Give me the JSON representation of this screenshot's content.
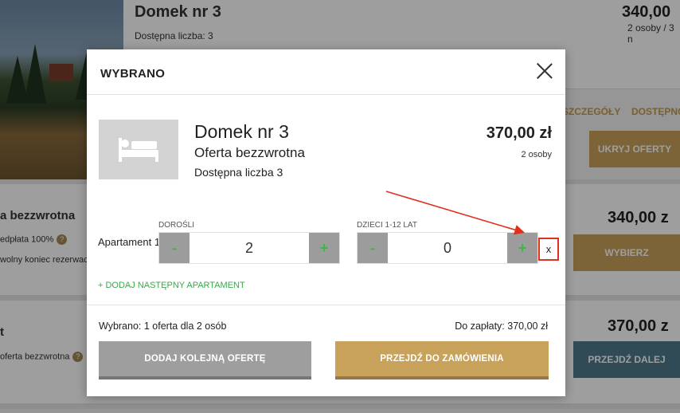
{
  "background": {
    "card1": {
      "title": "Domek nr 3",
      "availability": "Dostępna liczba: 3",
      "price": "340,00",
      "persons": "2 osoby / 3 n"
    },
    "links": {
      "details": "SZCZEGÓŁY",
      "availability": "DOSTĘPNO"
    },
    "hide_offers_button": "UKRYJ OFERTY",
    "card2": {
      "title": "a bezzwrotna",
      "line1": "edpłata 100%",
      "line2": "wolny koniec rezerwac",
      "price": "340,00 z",
      "button": "WYBIERZ"
    },
    "card3": {
      "title": "t",
      "line1": "ofertа bezzwrotna",
      "price": "370,00 z",
      "button": "PRZEJDŹ DALEJ"
    },
    "question_mark": "?"
  },
  "modal": {
    "title": "WYBRANO",
    "room": {
      "name": "Domek nr 3",
      "offer": "Oferta bezzwrotna",
      "availability": "Dostępna liczba 3",
      "price": "370,00 zł",
      "persons": "2 osoby"
    },
    "apartment_label": "Apartament 1",
    "adults": {
      "label": "DOROŚLI",
      "value": "2",
      "minus": "-",
      "plus": "+"
    },
    "children": {
      "label": "DZIECI 1-12 LAT",
      "value": "0",
      "minus": "-",
      "plus": "+"
    },
    "remove_label": "x",
    "add_apartment": "+ DODAJ NASTĘPNY APARTAMENT",
    "summary": {
      "selected": "Wybrano: 1 oferta dla 2 osób",
      "total": "Do zapłaty: 370,00 zł"
    },
    "buttons": {
      "add_offer": "DODAJ KOLEJNĄ OFERTĘ",
      "go_to_order": "PRZEJDŹ DO ZAMÓWIENIA"
    }
  },
  "colors": {
    "accent_gold": "#c8a25b",
    "plus_green": "#3cb84a",
    "annotation_red": "#e0301e",
    "button_grey": "#9e9e9e",
    "button_blue": "#4f7a8c"
  },
  "icons": {
    "room_placeholder": "bed-icon",
    "close": "close-icon"
  }
}
